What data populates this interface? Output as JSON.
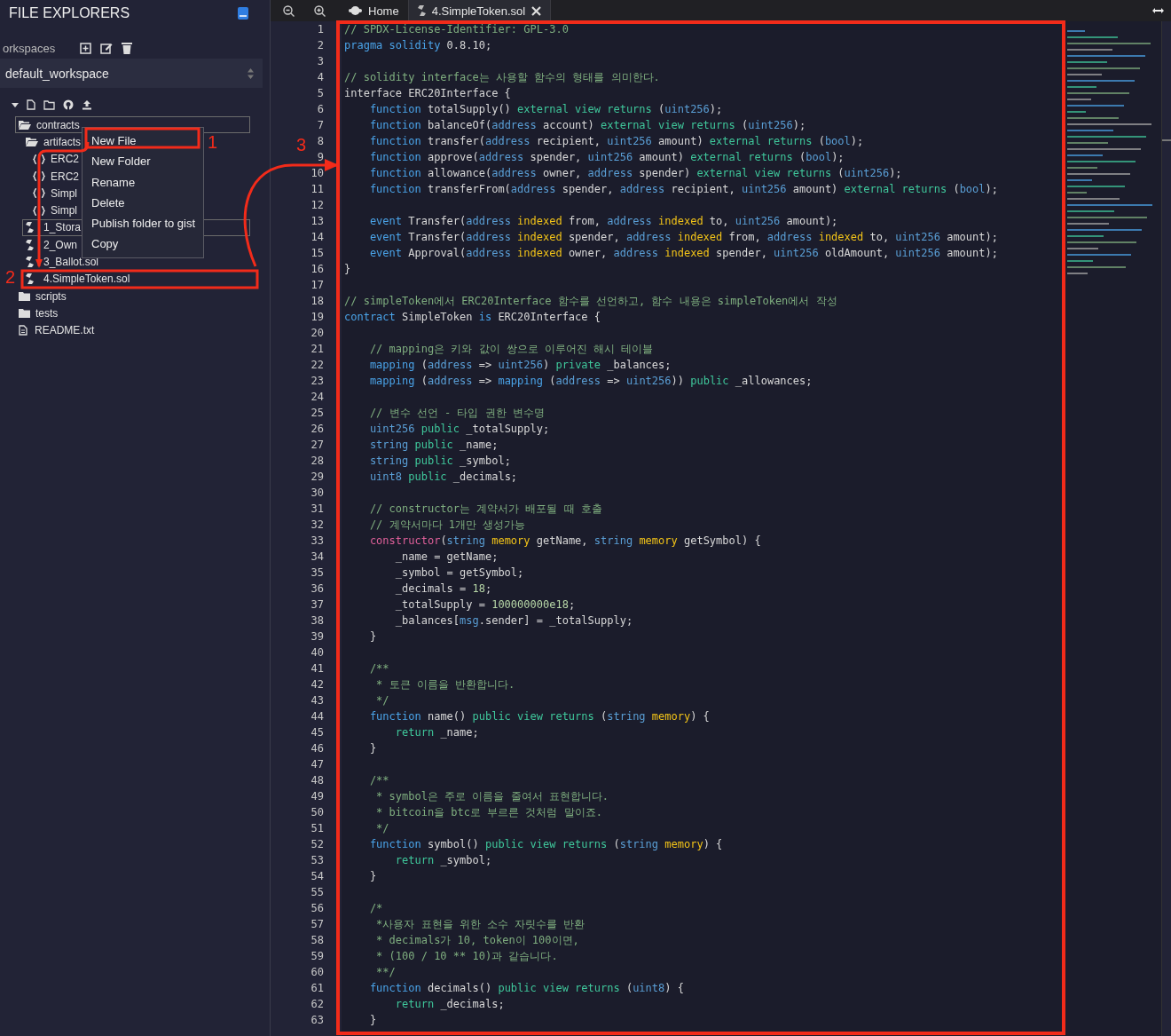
{
  "sidebar": {
    "title": "FILE EXPLORERS",
    "workspaces_label": "orkspaces",
    "workspace_select": {
      "value": "default_workspace"
    },
    "tree": [
      {
        "name": "contracts",
        "kind": "folder",
        "expanded": true,
        "selected": true,
        "children": [
          {
            "name": "artifacts",
            "kind": "folder",
            "expanded": true,
            "selected": false,
            "children": [
              {
                "name": "ERC2",
                "kind": "json",
                "selected": false
              },
              {
                "name": "ERC2",
                "kind": "json",
                "selected": false
              },
              {
                "name": "Simpl",
                "kind": "json",
                "selected": false
              },
              {
                "name": "Simpl",
                "kind": "json",
                "selected": false
              }
            ]
          },
          {
            "name": "1_Stora",
            "kind": "sol",
            "selected": true
          },
          {
            "name": "2_Own",
            "kind": "sol",
            "selected": false
          },
          {
            "name": "3_Ballot.sol",
            "kind": "sol",
            "selected": false
          },
          {
            "name": "4.SimpleToken.sol",
            "kind": "sol",
            "selected": false
          }
        ]
      },
      {
        "name": "scripts",
        "kind": "folder",
        "expanded": false,
        "selected": false
      },
      {
        "name": "tests",
        "kind": "folder",
        "expanded": false,
        "selected": false
      },
      {
        "name": "README.txt",
        "kind": "text",
        "selected": false
      }
    ]
  },
  "context_menu": {
    "items": [
      "New File",
      "New Folder",
      "Rename",
      "Delete",
      "Publish folder to gist",
      "Copy"
    ]
  },
  "tabs": [
    {
      "label": "Home",
      "kind": "home",
      "selected": false
    },
    {
      "label": "4.SimpleToken.sol",
      "kind": "file",
      "selected": true
    }
  ],
  "editor": {
    "lines": [
      {
        "number": "1",
        "segments": [
          {
            "kind": "comment",
            "text": "// SPDX-License-Identifier: GPL-3.0"
          }
        ]
      },
      {
        "number": "2",
        "segments": [
          {
            "kind": "keyword",
            "text": "pragma solidity"
          },
          {
            "kind": "plain",
            "text": " 0.8.10;"
          }
        ]
      },
      {
        "number": "3"
      },
      {
        "number": "4",
        "segments": [
          {
            "kind": "comment",
            "text": "// solidity interface는 사용할 함수의 형태를 의미한다."
          }
        ]
      },
      {
        "number": "5",
        "segments": [
          {
            "kind": "plain",
            "text": "interface ERC20Interface {"
          }
        ]
      },
      {
        "number": "6",
        "segments": [
          {
            "kind": "keyword",
            "text": "    function"
          },
          {
            "kind": "plain",
            "text": " totalSupply() "
          },
          {
            "kind": "modifier",
            "text": "external view returns"
          },
          {
            "kind": "plain",
            "text": " ("
          },
          {
            "kind": "type",
            "text": "uint256"
          },
          {
            "kind": "plain",
            "text": ");"
          }
        ]
      },
      {
        "number": "7",
        "segments": [
          {
            "kind": "keyword",
            "text": "    function"
          },
          {
            "kind": "plain",
            "text": " balanceOf("
          },
          {
            "kind": "type",
            "text": "address"
          },
          {
            "kind": "plain",
            "text": " account) "
          },
          {
            "kind": "modifier",
            "text": "external view returns"
          },
          {
            "kind": "plain",
            "text": " ("
          },
          {
            "kind": "type",
            "text": "uint256"
          },
          {
            "kind": "plain",
            "text": ");"
          }
        ]
      },
      {
        "number": "8",
        "segments": [
          {
            "kind": "keyword",
            "text": "    function"
          },
          {
            "kind": "plain",
            "text": " transfer("
          },
          {
            "kind": "type",
            "text": "address"
          },
          {
            "kind": "plain",
            "text": " recipient, "
          },
          {
            "kind": "type",
            "text": "uint256"
          },
          {
            "kind": "plain",
            "text": " amount) "
          },
          {
            "kind": "modifier",
            "text": "external returns"
          },
          {
            "kind": "plain",
            "text": " ("
          },
          {
            "kind": "type",
            "text": "bool"
          },
          {
            "kind": "plain",
            "text": ");"
          }
        ]
      },
      {
        "number": "9",
        "segments": [
          {
            "kind": "keyword",
            "text": "    function"
          },
          {
            "kind": "plain",
            "text": " approve("
          },
          {
            "kind": "type",
            "text": "address"
          },
          {
            "kind": "plain",
            "text": " spender, "
          },
          {
            "kind": "type",
            "text": "uint256"
          },
          {
            "kind": "plain",
            "text": " amount) "
          },
          {
            "kind": "modifier",
            "text": "external returns"
          },
          {
            "kind": "plain",
            "text": " ("
          },
          {
            "kind": "type",
            "text": "bool"
          },
          {
            "kind": "plain",
            "text": ");"
          }
        ]
      },
      {
        "number": "10",
        "segments": [
          {
            "kind": "keyword",
            "text": "    function"
          },
          {
            "kind": "plain",
            "text": " allowance("
          },
          {
            "kind": "type",
            "text": "address"
          },
          {
            "kind": "plain",
            "text": " owner, "
          },
          {
            "kind": "type",
            "text": "address"
          },
          {
            "kind": "plain",
            "text": " spender) "
          },
          {
            "kind": "modifier",
            "text": "external view returns"
          },
          {
            "kind": "plain",
            "text": " ("
          },
          {
            "kind": "type",
            "text": "uint256"
          },
          {
            "kind": "plain",
            "text": ");"
          }
        ]
      },
      {
        "number": "11",
        "segments": [
          {
            "kind": "keyword",
            "text": "    function"
          },
          {
            "kind": "plain",
            "text": " transferFrom("
          },
          {
            "kind": "type",
            "text": "address"
          },
          {
            "kind": "plain",
            "text": " spender, "
          },
          {
            "kind": "type",
            "text": "address"
          },
          {
            "kind": "plain",
            "text": " recipient, "
          },
          {
            "kind": "type",
            "text": "uint256"
          },
          {
            "kind": "plain",
            "text": " amount) "
          },
          {
            "kind": "modifier",
            "text": "external returns"
          },
          {
            "kind": "plain",
            "text": " ("
          },
          {
            "kind": "type",
            "text": "bool"
          },
          {
            "kind": "plain",
            "text": ");"
          }
        ]
      },
      {
        "number": "12"
      },
      {
        "number": "13",
        "segments": [
          {
            "kind": "keyword",
            "text": "    event"
          },
          {
            "kind": "plain",
            "text": " Transfer("
          },
          {
            "kind": "type",
            "text": "address "
          },
          {
            "kind": "storage",
            "text": "indexed"
          },
          {
            "kind": "plain",
            "text": " from, "
          },
          {
            "kind": "type",
            "text": "address "
          },
          {
            "kind": "storage",
            "text": "indexed"
          },
          {
            "kind": "plain",
            "text": " to, "
          },
          {
            "kind": "type",
            "text": "uint256"
          },
          {
            "kind": "plain",
            "text": " amount);"
          }
        ]
      },
      {
        "number": "14",
        "segments": [
          {
            "kind": "keyword",
            "text": "    event"
          },
          {
            "kind": "plain",
            "text": " Transfer("
          },
          {
            "kind": "type",
            "text": "address "
          },
          {
            "kind": "storage",
            "text": "indexed"
          },
          {
            "kind": "plain",
            "text": " spender, "
          },
          {
            "kind": "type",
            "text": "address "
          },
          {
            "kind": "storage",
            "text": "indexed"
          },
          {
            "kind": "plain",
            "text": " from, "
          },
          {
            "kind": "type",
            "text": "address "
          },
          {
            "kind": "storage",
            "text": "indexed"
          },
          {
            "kind": "plain",
            "text": " to, "
          },
          {
            "kind": "type",
            "text": "uint256"
          },
          {
            "kind": "plain",
            "text": " amount);"
          }
        ]
      },
      {
        "number": "15",
        "segments": [
          {
            "kind": "keyword",
            "text": "    event"
          },
          {
            "kind": "plain",
            "text": " Approval("
          },
          {
            "kind": "type",
            "text": "address "
          },
          {
            "kind": "storage",
            "text": "indexed"
          },
          {
            "kind": "plain",
            "text": " owner, "
          },
          {
            "kind": "type",
            "text": "address "
          },
          {
            "kind": "storage",
            "text": "indexed"
          },
          {
            "kind": "plain",
            "text": " spender, "
          },
          {
            "kind": "type",
            "text": "uint256"
          },
          {
            "kind": "plain",
            "text": " oldAmount, "
          },
          {
            "kind": "type",
            "text": "uint256"
          },
          {
            "kind": "plain",
            "text": " amount);"
          }
        ]
      },
      {
        "number": "16",
        "segments": [
          {
            "kind": "plain",
            "text": "}"
          }
        ]
      },
      {
        "number": "17"
      },
      {
        "number": "18",
        "segments": [
          {
            "kind": "comment",
            "text": "// simpleToken에서 ERC20Interface 함수를 선언하고, 함수 내용은 simpleToken에서 작성"
          }
        ]
      },
      {
        "number": "19",
        "segments": [
          {
            "kind": "keyword",
            "text": "contract"
          },
          {
            "kind": "plain",
            "text": " SimpleToken "
          },
          {
            "kind": "keyword",
            "text": "is"
          },
          {
            "kind": "plain",
            "text": " ERC20Interface {"
          }
        ]
      },
      {
        "number": "20"
      },
      {
        "number": "21",
        "segments": [
          {
            "kind": "comment",
            "text": "    // mapping은 키와 값이 쌍으로 이루어진 해시 테이블"
          }
        ]
      },
      {
        "number": "22",
        "segments": [
          {
            "kind": "keyword",
            "text": "    mapping"
          },
          {
            "kind": "plain",
            "text": " ("
          },
          {
            "kind": "type",
            "text": "address"
          },
          {
            "kind": "plain",
            "text": " => "
          },
          {
            "kind": "type",
            "text": "uint256"
          },
          {
            "kind": "plain",
            "text": ") "
          },
          {
            "kind": "modifier",
            "text": "private"
          },
          {
            "kind": "plain",
            "text": " _balances;"
          }
        ]
      },
      {
        "number": "23",
        "segments": [
          {
            "kind": "keyword",
            "text": "    mapping"
          },
          {
            "kind": "plain",
            "text": " ("
          },
          {
            "kind": "type",
            "text": "address"
          },
          {
            "kind": "plain",
            "text": " => "
          },
          {
            "kind": "keyword",
            "text": "mapping"
          },
          {
            "kind": "plain",
            "text": " ("
          },
          {
            "kind": "type",
            "text": "address"
          },
          {
            "kind": "plain",
            "text": " => "
          },
          {
            "kind": "type",
            "text": "uint256"
          },
          {
            "kind": "plain",
            "text": ")) "
          },
          {
            "kind": "modifier",
            "text": "public"
          },
          {
            "kind": "plain",
            "text": " _allowances;"
          }
        ]
      },
      {
        "number": "24"
      },
      {
        "number": "25",
        "segments": [
          {
            "kind": "comment",
            "text": "    // 변수 선언 - 타입 권한 변수명"
          }
        ]
      },
      {
        "number": "26",
        "segments": [
          {
            "kind": "type",
            "text": "    uint256 "
          },
          {
            "kind": "modifier",
            "text": "public"
          },
          {
            "kind": "plain",
            "text": " _totalSupply;"
          }
        ]
      },
      {
        "number": "27",
        "segments": [
          {
            "kind": "type",
            "text": "    string "
          },
          {
            "kind": "modifier",
            "text": "public"
          },
          {
            "kind": "plain",
            "text": " _name;"
          }
        ]
      },
      {
        "number": "28",
        "segments": [
          {
            "kind": "type",
            "text": "    string "
          },
          {
            "kind": "modifier",
            "text": "public"
          },
          {
            "kind": "plain",
            "text": " _symbol;"
          }
        ]
      },
      {
        "number": "29",
        "segments": [
          {
            "kind": "type",
            "text": "    uint8 "
          },
          {
            "kind": "modifier",
            "text": "public"
          },
          {
            "kind": "plain",
            "text": " _decimals;"
          }
        ]
      },
      {
        "number": "30"
      },
      {
        "number": "31",
        "segments": [
          {
            "kind": "comment",
            "text": "    // constructor는 계약서가 배포될 때 호출"
          }
        ]
      },
      {
        "number": "32",
        "segments": [
          {
            "kind": "comment",
            "text": "    // 계약서마다 1개만 생성가능"
          }
        ]
      },
      {
        "number": "33",
        "segments": [
          {
            "kind": "special",
            "text": "    constructor"
          },
          {
            "kind": "plain",
            "text": "("
          },
          {
            "kind": "type",
            "text": "string "
          },
          {
            "kind": "storage",
            "text": "memory"
          },
          {
            "kind": "plain",
            "text": " getName, "
          },
          {
            "kind": "type",
            "text": "string "
          },
          {
            "kind": "storage",
            "text": "memory"
          },
          {
            "kind": "plain",
            "text": " getSymbol) {"
          }
        ]
      },
      {
        "number": "34",
        "segments": [
          {
            "kind": "plain",
            "text": "        _name = getName;"
          }
        ]
      },
      {
        "number": "35",
        "segments": [
          {
            "kind": "plain",
            "text": "        _symbol = getSymbol;"
          }
        ]
      },
      {
        "number": "36",
        "segments": [
          {
            "kind": "plain",
            "text": "        _decimals = "
          },
          {
            "kind": "number",
            "text": "18"
          },
          {
            "kind": "plain",
            "text": ";"
          }
        ]
      },
      {
        "number": "37",
        "segments": [
          {
            "kind": "plain",
            "text": "        _totalSupply = "
          },
          {
            "kind": "number",
            "text": "100000000e18"
          },
          {
            "kind": "plain",
            "text": ";"
          }
        ]
      },
      {
        "number": "38",
        "segments": [
          {
            "kind": "plain",
            "text": "        _balances["
          },
          {
            "kind": "type",
            "text": "msg"
          },
          {
            "kind": "plain",
            "text": ".sender] = _totalSupply;"
          }
        ]
      },
      {
        "number": "39",
        "segments": [
          {
            "kind": "plain",
            "text": "    }"
          }
        ]
      },
      {
        "number": "40"
      },
      {
        "number": "41",
        "segments": [
          {
            "kind": "comment",
            "text": "    /**"
          }
        ]
      },
      {
        "number": "42",
        "segments": [
          {
            "kind": "comment",
            "text": "     * 토큰 이름을 반환합니다."
          }
        ]
      },
      {
        "number": "43",
        "segments": [
          {
            "kind": "comment",
            "text": "     */"
          }
        ]
      },
      {
        "number": "44",
        "segments": [
          {
            "kind": "keyword",
            "text": "    function"
          },
          {
            "kind": "plain",
            "text": " name() "
          },
          {
            "kind": "modifier",
            "text": "public view returns"
          },
          {
            "kind": "plain",
            "text": " ("
          },
          {
            "kind": "type",
            "text": "string "
          },
          {
            "kind": "storage",
            "text": "memory"
          },
          {
            "kind": "plain",
            "text": ") {"
          }
        ]
      },
      {
        "number": "45",
        "segments": [
          {
            "kind": "modifier",
            "text": "        return"
          },
          {
            "kind": "plain",
            "text": " _name;"
          }
        ]
      },
      {
        "number": "46",
        "segments": [
          {
            "kind": "plain",
            "text": "    }"
          }
        ]
      },
      {
        "number": "47"
      },
      {
        "number": "48",
        "segments": [
          {
            "kind": "comment",
            "text": "    /**"
          }
        ]
      },
      {
        "number": "49",
        "segments": [
          {
            "kind": "comment",
            "text": "     * symbol은 주로 이름을 줄여서 표현합니다."
          }
        ]
      },
      {
        "number": "50",
        "segments": [
          {
            "kind": "comment",
            "text": "     * bitcoin을 btc로 부르른 것처럼 말이죠."
          }
        ]
      },
      {
        "number": "51",
        "segments": [
          {
            "kind": "comment",
            "text": "     */"
          }
        ]
      },
      {
        "number": "52",
        "segments": [
          {
            "kind": "keyword",
            "text": "    function"
          },
          {
            "kind": "plain",
            "text": " symbol() "
          },
          {
            "kind": "modifier",
            "text": "public view returns"
          },
          {
            "kind": "plain",
            "text": " ("
          },
          {
            "kind": "type",
            "text": "string "
          },
          {
            "kind": "storage",
            "text": "memory"
          },
          {
            "kind": "plain",
            "text": ") {"
          }
        ]
      },
      {
        "number": "53",
        "segments": [
          {
            "kind": "modifier",
            "text": "        return"
          },
          {
            "kind": "plain",
            "text": " _symbol;"
          }
        ]
      },
      {
        "number": "54",
        "segments": [
          {
            "kind": "plain",
            "text": "    }"
          }
        ]
      },
      {
        "number": "55"
      },
      {
        "number": "56",
        "segments": [
          {
            "kind": "comment",
            "text": "    /*"
          }
        ]
      },
      {
        "number": "57",
        "segments": [
          {
            "kind": "comment",
            "text": "     *사용자 표현을 위한 소수 자릿수를 반환"
          }
        ]
      },
      {
        "number": "58",
        "segments": [
          {
            "kind": "comment",
            "text": "     * decimals가 10, token이 100이면,"
          }
        ]
      },
      {
        "number": "59",
        "segments": [
          {
            "kind": "comment",
            "text": "     * (100 / 10 ** 10)과 같습니다."
          }
        ]
      },
      {
        "number": "60",
        "segments": [
          {
            "kind": "comment",
            "text": "     **/"
          }
        ]
      },
      {
        "number": "61",
        "segments": [
          {
            "kind": "keyword",
            "text": "    function"
          },
          {
            "kind": "plain",
            "text": " decimals() "
          },
          {
            "kind": "modifier",
            "text": "public view returns"
          },
          {
            "kind": "plain",
            "text": " ("
          },
          {
            "kind": "type",
            "text": "uint8"
          },
          {
            "kind": "plain",
            "text": ") {"
          }
        ]
      },
      {
        "number": "62",
        "segments": [
          {
            "kind": "modifier",
            "text": "        return"
          },
          {
            "kind": "plain",
            "text": " _decimals;"
          }
        ]
      },
      {
        "number": "63",
        "segments": [
          {
            "kind": "plain",
            "text": "    }"
          }
        ]
      }
    ]
  },
  "annotations": {
    "labels": [
      "1",
      "2",
      "3"
    ]
  }
}
